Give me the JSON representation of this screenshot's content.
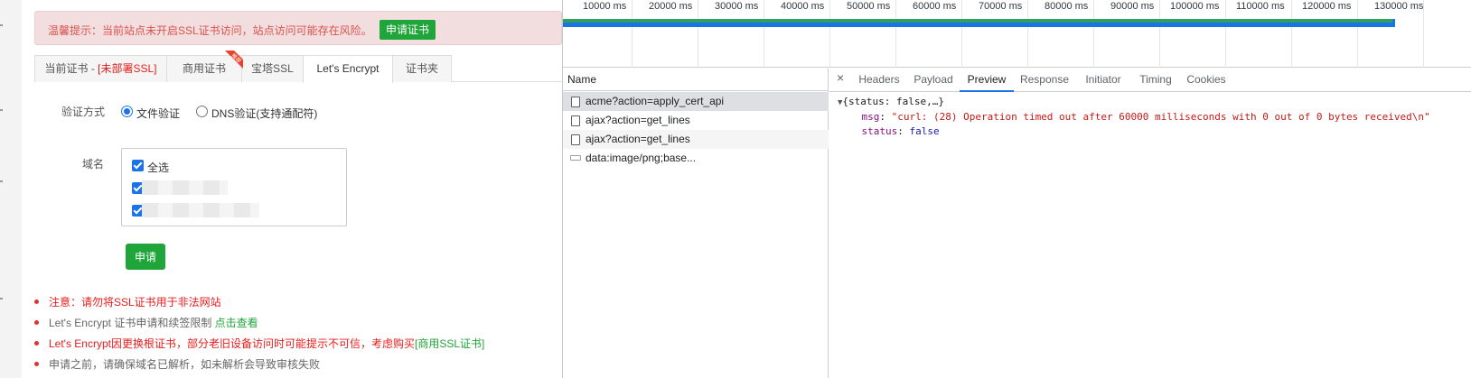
{
  "warning": {
    "text": "温馨提示：当前站点未开启SSL证书访问，站点访问可能存在风险。",
    "button": "申请证书"
  },
  "tabs": [
    {
      "label": "当前证书 - ",
      "extra": "[未部署SSL]"
    },
    {
      "label": "商用证书",
      "badge": "推荐"
    },
    {
      "label": "宝塔SSL"
    },
    {
      "label": "Let's Encrypt",
      "active": true
    },
    {
      "label": "证书夹"
    }
  ],
  "verify": {
    "label": "验证方式",
    "options": [
      {
        "label": "文件验证",
        "selected": true
      },
      {
        "label": "DNS验证(支持通配符)",
        "selected": false
      }
    ]
  },
  "domains": {
    "label": "域名",
    "select_all": "全选"
  },
  "apply_button": "申请",
  "notes": [
    {
      "text": "注意：请勿将SSL证书用于非法网站"
    },
    {
      "prefix": "Let's Encrypt 证书申请和续签限制 ",
      "link": "点击查看"
    },
    {
      "text": "Let's Encrypt因更换根证书，部分老旧设备访问时可能提示不可信，考虑购买",
      "link": "[商用SSL证书]"
    },
    {
      "text": "申请之前，请确保域名已解析，如未解析会导致审核失败"
    }
  ],
  "timeline": {
    "ticks": [
      "10000 ms",
      "20000 ms",
      "30000 ms",
      "40000 ms",
      "50000 ms",
      "60000 ms",
      "70000 ms",
      "80000 ms",
      "90000 ms",
      "100000 ms",
      "110000 ms",
      "120000 ms",
      "130000 ms"
    ]
  },
  "network": {
    "column": "Name",
    "requests": [
      {
        "name": "acme?action=apply_cert_api",
        "selected": true
      },
      {
        "name": "ajax?action=get_lines"
      },
      {
        "name": "ajax?action=get_lines"
      },
      {
        "name": "data:image/png;base..."
      }
    ]
  },
  "detail": {
    "close": "×",
    "tabs": [
      "Headers",
      "Payload",
      "Preview",
      "Response",
      "Initiator",
      "Timing",
      "Cookies"
    ],
    "active_tab": "Preview",
    "preview": {
      "summary": "{status: false,…}",
      "msg_key": "msg",
      "msg_value": "\"curl: (28) Operation timed out after 60000 milliseconds with 0 out of 0 bytes received\\n\"",
      "status_key": "status",
      "status_value": "false"
    }
  },
  "colors": {
    "accent_green": "#20a53a",
    "warning_red": "#e81c1c",
    "devtools_blue": "#1a73e8"
  }
}
